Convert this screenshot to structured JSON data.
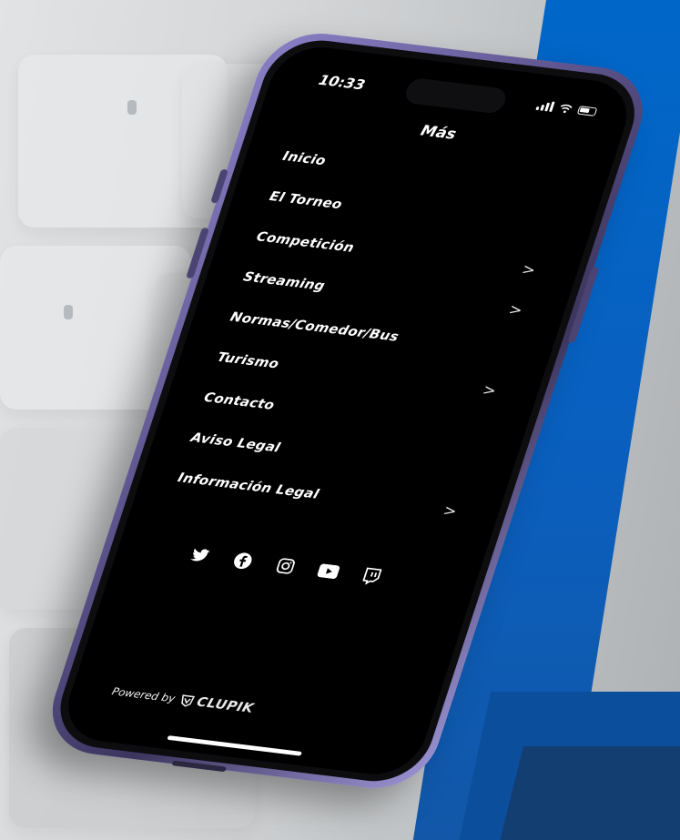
{
  "colors": {
    "accent_blue": "#0067c9",
    "screen_bg": "#000000",
    "text": "#ffffff",
    "phone_frame": "#6a62a0"
  },
  "status_bar": {
    "time": "10:33",
    "icons": [
      "signal-icon",
      "wifi-icon",
      "battery-icon"
    ]
  },
  "screen": {
    "title": "Más"
  },
  "menu": {
    "items": [
      {
        "label": "Inicio",
        "has_chevron": false
      },
      {
        "label": "El Torneo",
        "has_chevron": false
      },
      {
        "label": "Competición",
        "has_chevron": true
      },
      {
        "label": "Streaming",
        "has_chevron": true
      },
      {
        "label": "Normas/Comedor/Bus",
        "has_chevron": false
      },
      {
        "label": "Turismo",
        "has_chevron": true
      },
      {
        "label": "Contacto",
        "has_chevron": false
      },
      {
        "label": "Aviso Legal",
        "has_chevron": false
      },
      {
        "label": "Información Legal",
        "has_chevron": true
      }
    ],
    "chevron": ">"
  },
  "socials": [
    "twitter-icon",
    "facebook-icon",
    "instagram-icon",
    "youtube-icon",
    "twitch-icon"
  ],
  "footer": {
    "powered_by": "Powered by",
    "brand": "CLUPIK",
    "brand_icon": "clupik-logo-icon"
  }
}
